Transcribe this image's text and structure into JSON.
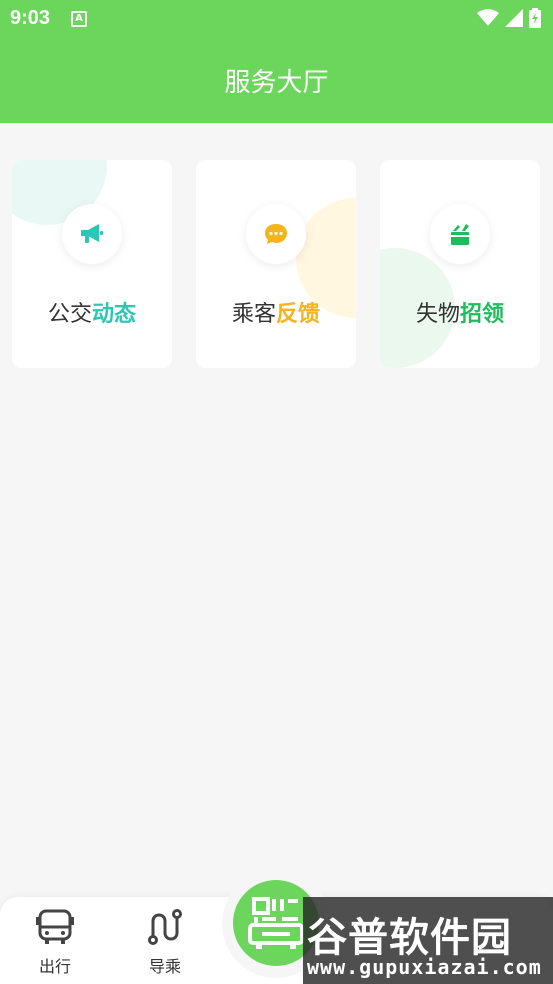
{
  "status_bar": {
    "time": "9:03",
    "notification_icon": "A"
  },
  "header": {
    "title": "服务大厅"
  },
  "cards": [
    {
      "label_plain": "公交",
      "label_highlight": "动态",
      "icon": "megaphone-icon"
    },
    {
      "label_plain": "乘客",
      "label_highlight": "反馈",
      "icon": "chat-bubble-icon"
    },
    {
      "label_plain": "失物",
      "label_highlight": "招领",
      "icon": "lost-box-icon"
    }
  ],
  "tabbar": {
    "tabs": [
      {
        "label": "出行",
        "icon": "bus-icon"
      },
      {
        "label": "导乘",
        "icon": "route-icon"
      }
    ],
    "center_icon": "qr-bus-icon"
  },
  "watermark": {
    "main": "谷普软件园",
    "sub": "www.gupuxiazai.com"
  },
  "colors": {
    "accent": "#6bd65b",
    "teal": "#2cc6b6",
    "amber": "#f4b41a",
    "green": "#1dbd5c"
  }
}
